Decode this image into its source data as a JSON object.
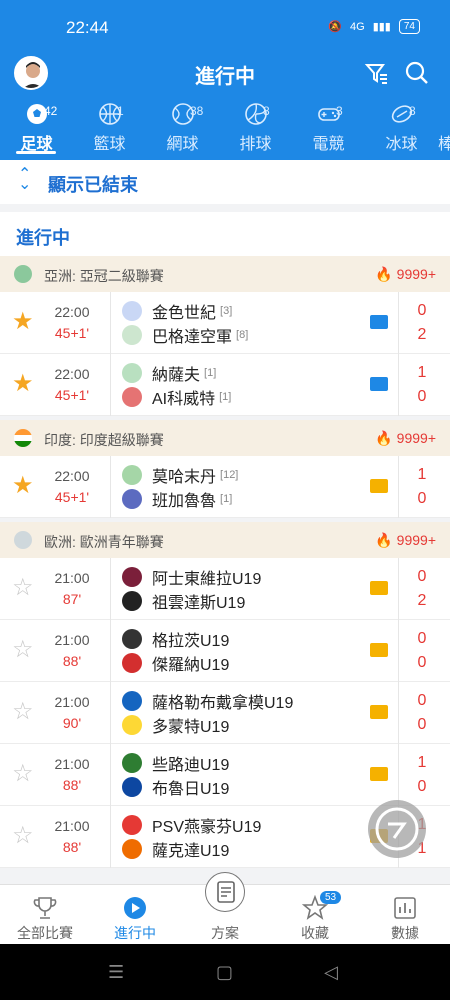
{
  "status_bar": {
    "time": "22:44",
    "network": "4G",
    "battery": "74"
  },
  "header": {
    "title": "進行中"
  },
  "sport_tabs": [
    {
      "label": "足球",
      "count": "42",
      "active": true
    },
    {
      "label": "籃球",
      "count": "1"
    },
    {
      "label": "網球",
      "count": "38"
    },
    {
      "label": "排球",
      "count": "8"
    },
    {
      "label": "電競",
      "count": "3"
    },
    {
      "label": "冰球",
      "count": "8"
    },
    {
      "label": "棒",
      "count": ""
    }
  ],
  "show_finished": "顯示已結束",
  "section_title": "進行中",
  "leagues": [
    {
      "name": "亞洲: 亞冠二級聯賽",
      "heat": "9999+"
    },
    {
      "name": "印度: 印度超級聯賽",
      "heat": "9999+"
    },
    {
      "name": "歐洲: 歐洲青年聯賽",
      "heat": "9999+"
    }
  ],
  "matches": [
    {
      "time": "22:00",
      "minute": "45+1'",
      "home": "金色世紀",
      "home_rank": "[3]",
      "away": "巴格達空軍",
      "away_rank": "[8]",
      "home_score": "0",
      "away_score": "2",
      "media": "video",
      "starred": true
    },
    {
      "time": "22:00",
      "minute": "45+1'",
      "home": "納薩夫",
      "home_rank": "[1]",
      "away": "AI科威特",
      "away_rank": "[1]",
      "home_score": "1",
      "away_score": "0",
      "media": "video",
      "starred": true
    },
    {
      "time": "22:00",
      "minute": "45+1'",
      "home": "莫哈末丹",
      "home_rank": "[12]",
      "away": "班加魯魯",
      "away_rank": "[1]",
      "home_score": "1",
      "away_score": "0",
      "media": "field",
      "starred": true
    },
    {
      "time": "21:00",
      "minute": "87'",
      "home": "阿士東維拉U19",
      "home_rank": "",
      "away": "祖雲達斯U19",
      "away_rank": "",
      "home_score": "0",
      "away_score": "2",
      "media": "field",
      "starred": false
    },
    {
      "time": "21:00",
      "minute": "88'",
      "home": "格拉茨U19",
      "home_rank": "",
      "away": "傑羅納U19",
      "away_rank": "",
      "home_score": "0",
      "away_score": "0",
      "media": "field",
      "starred": false
    },
    {
      "time": "21:00",
      "minute": "90'",
      "home": "薩格勒布戴拿模U19",
      "home_rank": "",
      "away": "多蒙特U19",
      "away_rank": "",
      "home_score": "0",
      "away_score": "0",
      "media": "field",
      "starred": false
    },
    {
      "time": "21:00",
      "minute": "88'",
      "home": "些路迪U19",
      "home_rank": "",
      "away": "布魯日U19",
      "away_rank": "",
      "home_score": "1",
      "away_score": "0",
      "media": "field",
      "starred": false
    },
    {
      "time": "21:00",
      "minute": "88'",
      "home": "PSV燕豪芬U19",
      "home_rank": "",
      "away": "薩克達U19",
      "away_rank": "",
      "home_score": "1",
      "away_score": "1",
      "media": "field",
      "starred": false
    }
  ],
  "bottom_nav": [
    {
      "label": "全部比賽"
    },
    {
      "label": "進行中",
      "active": true
    },
    {
      "label": "方案"
    },
    {
      "label": "收藏",
      "badge": "53"
    },
    {
      "label": "數據"
    }
  ],
  "colors": {
    "primary": "#1e88e5",
    "score_red": "#e53935",
    "star_gold": "#f5a623",
    "league_bg": "#f6efe3"
  }
}
